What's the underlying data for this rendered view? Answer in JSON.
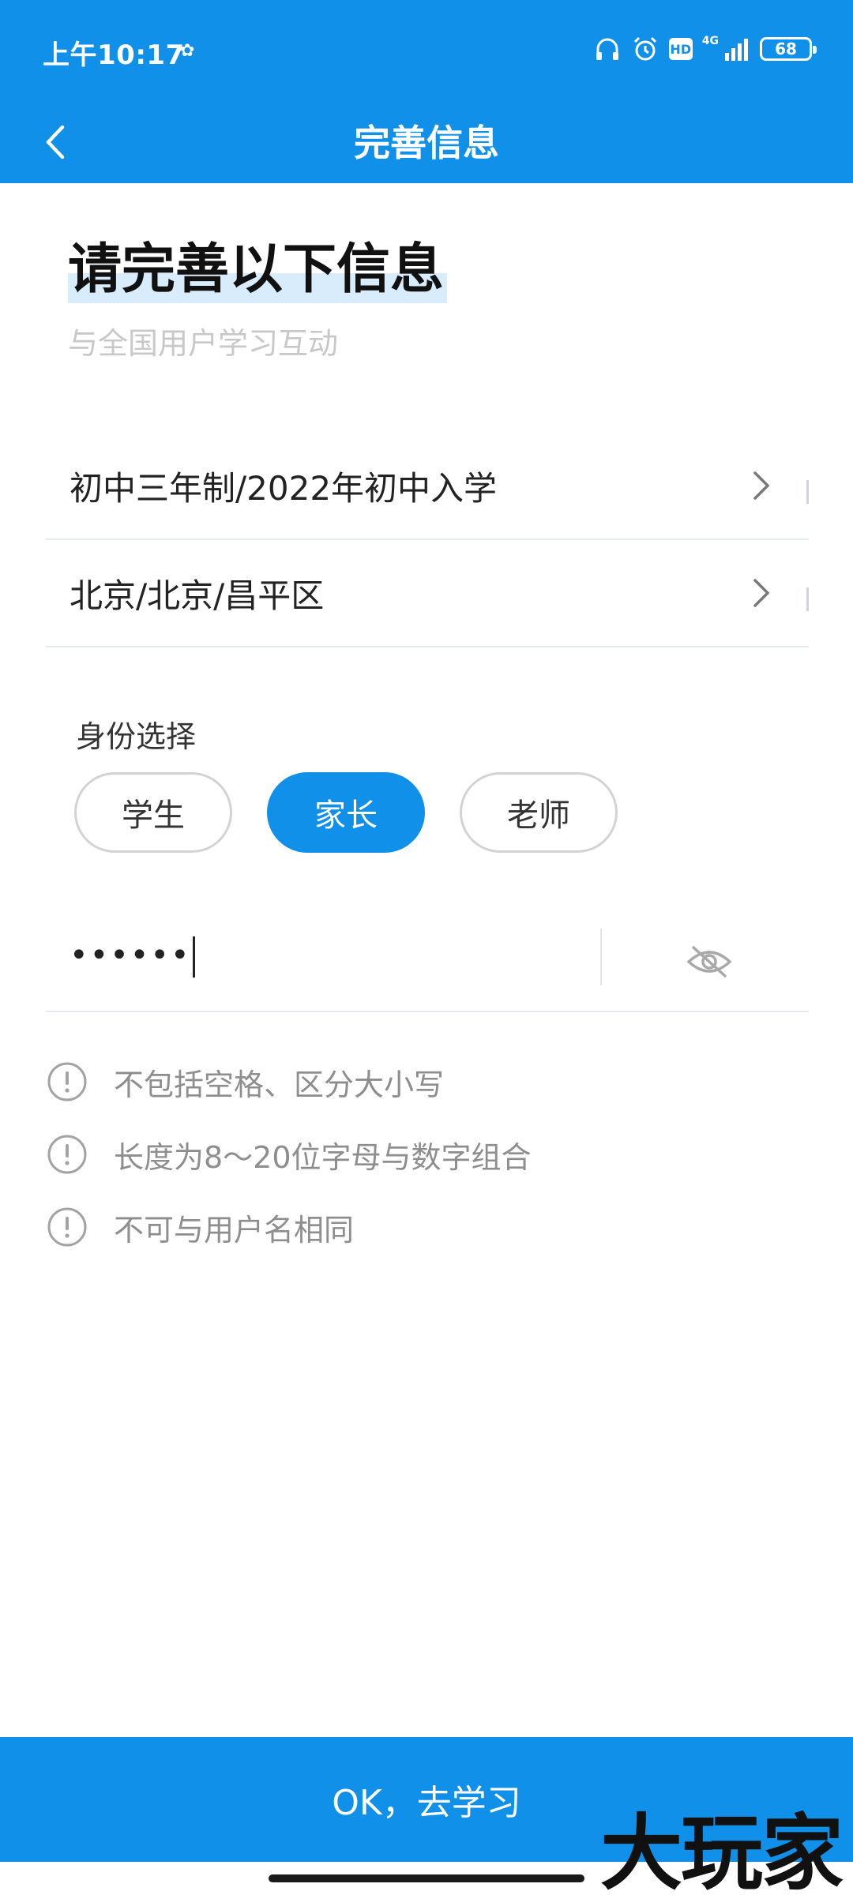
{
  "status": {
    "time": "上午10:17",
    "network": "4G",
    "hd": "HD",
    "battery": "68"
  },
  "header": {
    "title": "完善信息"
  },
  "intro": {
    "heading": "请完善以下信息",
    "subheading": "与全国用户学习互动"
  },
  "pickers": {
    "grade": "初中三年制/2022年初中入学",
    "region": "北京/北京/昌平区"
  },
  "identity": {
    "label": "身份选择",
    "options": [
      "学生",
      "家长",
      "老师"
    ],
    "selected": "家长"
  },
  "password": {
    "value": "••••••"
  },
  "rules": [
    "不包括空格、区分大小写",
    "长度为8～20位字母与数字组合",
    "不可与用户名相同"
  ],
  "submit": {
    "label": "OK，去学习"
  },
  "watermark": "大玩家",
  "colors": {
    "primary": "#1090e8",
    "text": "#222222",
    "hint": "#8e8e8e",
    "placeholder": "#c8c8c8"
  }
}
